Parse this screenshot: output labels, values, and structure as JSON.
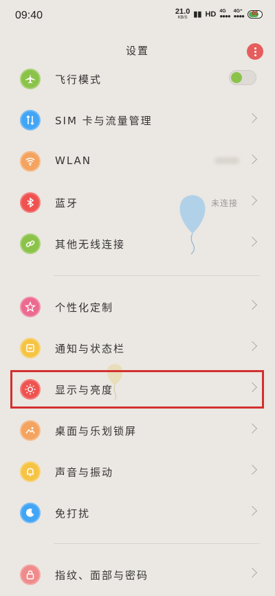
{
  "status_bar": {
    "time": "09:40",
    "net_speed": "21.0",
    "net_speed_unit": "KB/S",
    "hd_label": "HD",
    "signal1": "4G",
    "signal2": "4G⁺",
    "battery_level": "85",
    "battery_color": "#4caf50"
  },
  "header": {
    "title": "设置"
  },
  "section1": [
    {
      "label": "飞行模式",
      "icon": "airplane-icon",
      "color": "#8bc34a",
      "control": "toggle"
    },
    {
      "label": "SIM 卡与流量管理",
      "icon": "sim-data-icon",
      "color": "#42a5f5",
      "control": "chevron"
    },
    {
      "label": "WLAN",
      "icon": "wifi-icon",
      "color": "#f4a460",
      "control": "chevron"
    },
    {
      "label": "蓝牙",
      "icon": "bluetooth-icon",
      "color": "#ef5350",
      "control": "chevron",
      "value": "未连接"
    },
    {
      "label": "其他无线连接",
      "icon": "link-icon",
      "color": "#8bc34a",
      "control": "chevron"
    }
  ],
  "section2": [
    {
      "label": "个性化定制",
      "icon": "customize-icon",
      "color": "#ec6a8f",
      "control": "chevron"
    },
    {
      "label": "通知与状态栏",
      "icon": "notification-icon",
      "color": "#f6c445",
      "control": "chevron"
    },
    {
      "label": "显示与亮度",
      "icon": "brightness-icon",
      "color": "#ef5350",
      "control": "chevron"
    },
    {
      "label": "桌面与乐划锁屏",
      "icon": "desktop-icon",
      "color": "#f4a460",
      "control": "chevron"
    },
    {
      "label": "声音与振动",
      "icon": "bell-icon",
      "color": "#f6c445",
      "control": "chevron"
    },
    {
      "label": "免打扰",
      "icon": "moon-icon",
      "color": "#42a5f5",
      "control": "chevron"
    }
  ],
  "section3": [
    {
      "label": "指纹、面部与密码",
      "icon": "lock-icon",
      "color": "#ef8b8b",
      "control": "chevron"
    }
  ]
}
